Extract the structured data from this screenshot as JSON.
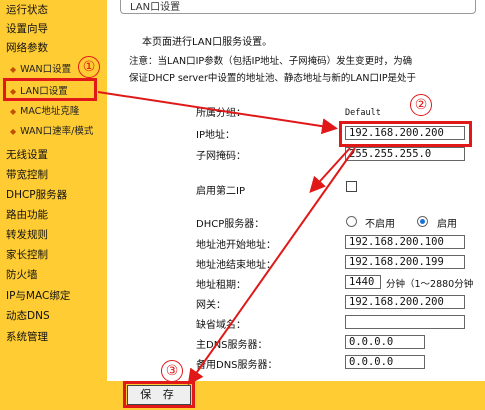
{
  "sidebar": {
    "items": [
      {
        "label": "运行状态",
        "sub": false
      },
      {
        "label": "设置向导",
        "sub": false
      },
      {
        "label": "网络参数",
        "sub": false
      },
      {
        "label": "WAN口设置",
        "sub": true
      },
      {
        "label": "LAN口设置",
        "sub": true
      },
      {
        "label": "MAC地址克隆",
        "sub": true
      },
      {
        "label": "WAN口速率/模式",
        "sub": true
      },
      {
        "label": "无线设置",
        "sub": false
      },
      {
        "label": "带宽控制",
        "sub": false
      },
      {
        "label": "DHCP服务器",
        "sub": false
      },
      {
        "label": "路由功能",
        "sub": false
      },
      {
        "label": "转发规则",
        "sub": false
      },
      {
        "label": "家长控制",
        "sub": false
      },
      {
        "label": "防火墙",
        "sub": false
      },
      {
        "label": "IP与MAC绑定",
        "sub": false
      },
      {
        "label": "动态DNS",
        "sub": false
      },
      {
        "label": "系统管理",
        "sub": false
      }
    ]
  },
  "page": {
    "title": "LAN口设置",
    "intro": "本页面进行LAN口服务设置。",
    "note_line1": "注意：当LAN口IP参数（包括IP地址、子网掩码）发生变更时，为确",
    "note_line2": "保证DHCP server中设置的地址池、静态地址与新的LAN口IP是处于"
  },
  "form": {
    "group_label": "所属分组：",
    "group_value": "Default",
    "ip_label": "IP地址：",
    "ip_value": "192.168.200.200",
    "mask_label": "子网掩码：",
    "mask_value": "255.255.255.0",
    "second_ip_label": "启用第二IP",
    "dhcp_label": "DHCP服务器：",
    "dhcp_off": "不启用",
    "dhcp_on": "启用",
    "pool_start_label": "地址池开始地址：",
    "pool_start_value": "192.168.200.100",
    "pool_end_label": "地址池结束地址：",
    "pool_end_value": "192.168.200.199",
    "lease_label": "地址租期：",
    "lease_value": "1440",
    "lease_unit": "分钟（1～2880分钟",
    "gateway_label": "网关：",
    "gateway_value": "192.168.200.200",
    "domain_label": "缺省域名：",
    "domain_value": "",
    "dns1_label": "主DNS服务器：",
    "dns1_value": "0.0.0.0",
    "dns2_label": "备用DNS服务器：",
    "dns2_value": "0.0.0.0"
  },
  "actions": {
    "save_label": "保 存"
  },
  "annotations": {
    "step1": "①",
    "step2": "②",
    "step3": "③",
    "color": "#e01818"
  }
}
